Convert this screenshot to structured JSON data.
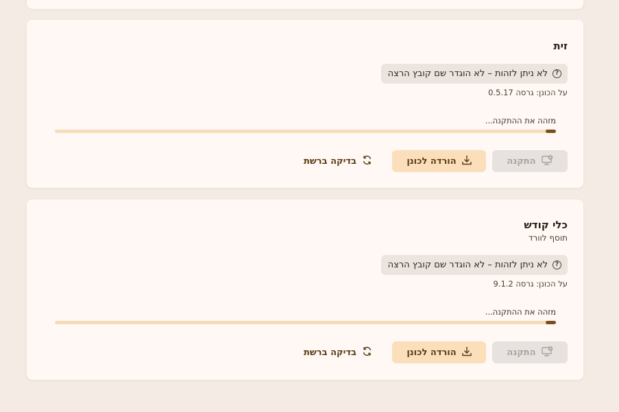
{
  "cards": [
    {
      "title": "זית",
      "subtitle": "",
      "status_text": "לא ניתן לזהות – לא הוגדר שם קובץ הרצה",
      "version_text": "על הכונן: גרסה 0.5.17",
      "progress_label": "מזהה את ההתקנה...",
      "progress_fraction": 0.02,
      "install_label": "התקנה",
      "download_label": "הורדה לכונן",
      "recheck_label": "בדיקה ברשת"
    },
    {
      "title": "כלי קודש",
      "subtitle": "תוסף לוורד",
      "status_text": "לא ניתן לזהות – לא הוגדר שם קובץ הרצה",
      "version_text": "על הכונן: גרסה 9.1.2",
      "progress_label": "מזהה את ההתקנה...",
      "progress_fraction": 0.02,
      "install_label": "התקנה",
      "download_label": "הורדה לכונן",
      "recheck_label": "בדיקה ברשת"
    }
  ],
  "icons": {
    "status": "help-circle-icon",
    "install": "monitor-install-icon",
    "download": "download-icon",
    "recheck": "refresh-icon"
  },
  "colors": {
    "background": "#f4ece4",
    "card": "#fff8f4",
    "progress_track": "#f6ddba",
    "progress_fill": "#7a4f1e",
    "download_button": "#fadfba",
    "install_button_disabled": "#e7e2df"
  }
}
